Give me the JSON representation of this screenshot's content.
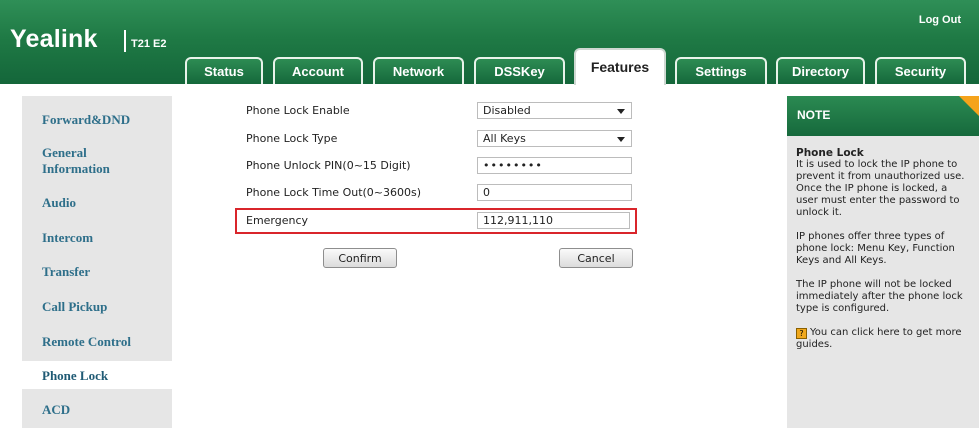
{
  "header": {
    "brand": "Yealink",
    "model": "T21 E2",
    "logout": "Log Out"
  },
  "tabs": [
    {
      "label": "Status"
    },
    {
      "label": "Account"
    },
    {
      "label": "Network"
    },
    {
      "label": "DSSKey"
    },
    {
      "label": "Features",
      "active": true
    },
    {
      "label": "Settings"
    },
    {
      "label": "Directory"
    },
    {
      "label": "Security"
    }
  ],
  "sidebar": {
    "items": [
      {
        "label": "Forward&DND"
      },
      {
        "label": "General Information"
      },
      {
        "label": "Audio"
      },
      {
        "label": "Intercom"
      },
      {
        "label": "Transfer"
      },
      {
        "label": "Call Pickup"
      },
      {
        "label": "Remote Control"
      },
      {
        "label": "Phone Lock",
        "active": true
      },
      {
        "label": "ACD"
      }
    ]
  },
  "form": {
    "rows": [
      {
        "label": "Phone Lock Enable",
        "value": "Disabled",
        "type": "select"
      },
      {
        "label": "Phone Lock Type",
        "value": "All Keys",
        "type": "select"
      },
      {
        "label": "Phone Unlock PIN(0~15 Digit)",
        "value": "••••••••",
        "type": "password"
      },
      {
        "label": "Phone Lock Time Out(0~3600s)",
        "value": "0",
        "type": "text"
      },
      {
        "label": "Emergency",
        "value": "112,911,110",
        "type": "text"
      }
    ],
    "confirm_label": "Confirm",
    "cancel_label": "Cancel"
  },
  "note": {
    "title": "NOTE",
    "heading": "Phone Lock",
    "paragraphs": [
      "It is used to lock the IP phone to prevent it from unauthorized use. Once the IP phone is locked, a user must enter the password to unlock it.",
      "IP phones offer three types of phone lock: Menu Key, Function Keys and All Keys.",
      "The IP phone will not be locked immediately after the phone lock type is configured."
    ],
    "guide_text": "You can click here to get more guides."
  },
  "colors": {
    "header_green": "#1f7a45",
    "accent_orange": "#f5a31b",
    "highlight_red": "#d9252b",
    "sidebar_link": "#2e6f8a"
  }
}
